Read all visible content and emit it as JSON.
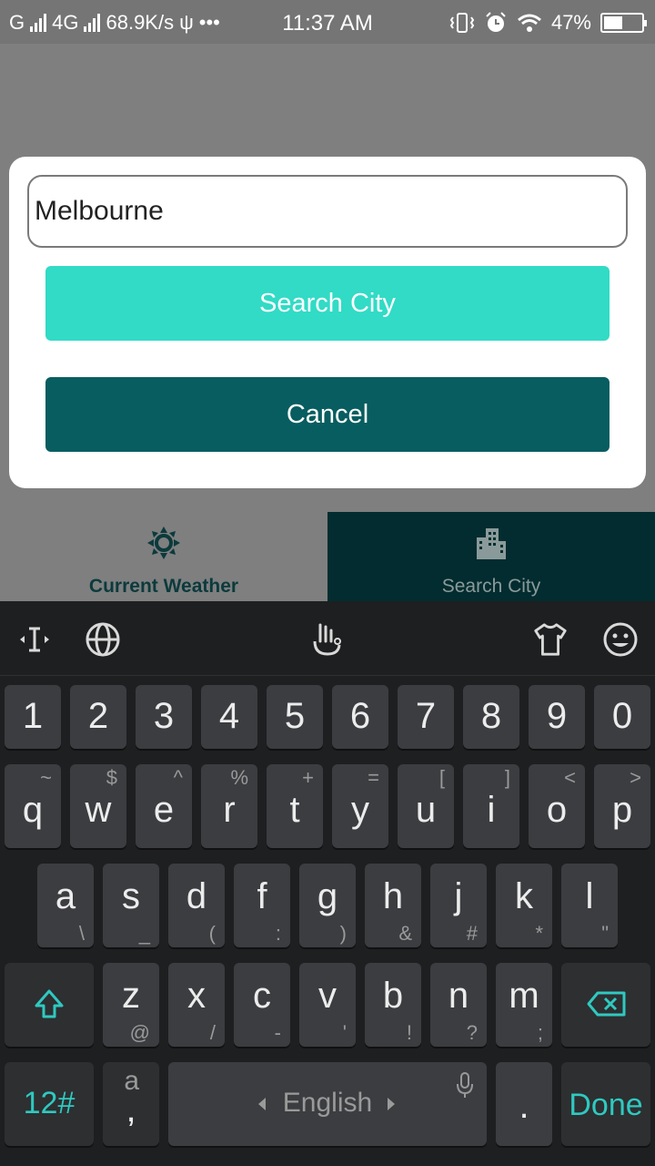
{
  "status_bar": {
    "carrier": "G",
    "network": "4G",
    "speed": "68.9K/s",
    "usb": "ψ",
    "more": "•••",
    "time": "11:37 AM",
    "battery": "47%",
    "battery_level": 0.47
  },
  "dialog": {
    "city_value": "Melbourne",
    "search_label": "Search City",
    "cancel_label": "Cancel"
  },
  "bottom_nav": {
    "items": [
      {
        "label": "Current Weather",
        "icon": "sun-icon"
      },
      {
        "label": "Search City",
        "icon": "city-buildings-icon"
      }
    ]
  },
  "keyboard": {
    "toolbar": {
      "cursor": "cursor-move-icon",
      "globe": "globe-icon",
      "gesture": "touch-gesture-icon",
      "theme": "shirt-theme-icon",
      "emoji": "emoji-icon"
    },
    "number_row": [
      "1",
      "2",
      "3",
      "4",
      "5",
      "6",
      "7",
      "8",
      "9",
      "0"
    ],
    "row1": [
      {
        "main": "q",
        "sup": "~"
      },
      {
        "main": "w",
        "sup": "$"
      },
      {
        "main": "e",
        "sup": "^"
      },
      {
        "main": "r",
        "sup": "%"
      },
      {
        "main": "t",
        "sup": "+"
      },
      {
        "main": "y",
        "sup": "="
      },
      {
        "main": "u",
        "sup": "["
      },
      {
        "main": "i",
        "sup": "]"
      },
      {
        "main": "o",
        "sup": "<"
      },
      {
        "main": "p",
        "sup": ">"
      }
    ],
    "row2": [
      {
        "main": "a",
        "sub": "\\"
      },
      {
        "main": "s",
        "sub": "_"
      },
      {
        "main": "d",
        "sub": "("
      },
      {
        "main": "f",
        "sub": ":"
      },
      {
        "main": "g",
        "sub": ")"
      },
      {
        "main": "h",
        "sub": "&"
      },
      {
        "main": "j",
        "sub": "#"
      },
      {
        "main": "k",
        "sub": "*"
      },
      {
        "main": "l",
        "sub": "\""
      }
    ],
    "row3": [
      {
        "main": "z",
        "sub": "@"
      },
      {
        "main": "x",
        "sub": "/"
      },
      {
        "main": "c",
        "sub": "-"
      },
      {
        "main": "v",
        "sub": "'"
      },
      {
        "main": "b",
        "sub": "!"
      },
      {
        "main": "n",
        "sub": "?"
      },
      {
        "main": "m",
        "sub": ";"
      }
    ],
    "symbols_label": "12#",
    "comma_top": "a",
    "comma_label": ",",
    "space_label": "English",
    "period_label": ".",
    "done_label": "Done"
  },
  "colors": {
    "search_button": "#31dbc5",
    "cancel_button": "#075d60",
    "nav_active_bg": "#022c2f",
    "accent": "#2fc9c0"
  }
}
